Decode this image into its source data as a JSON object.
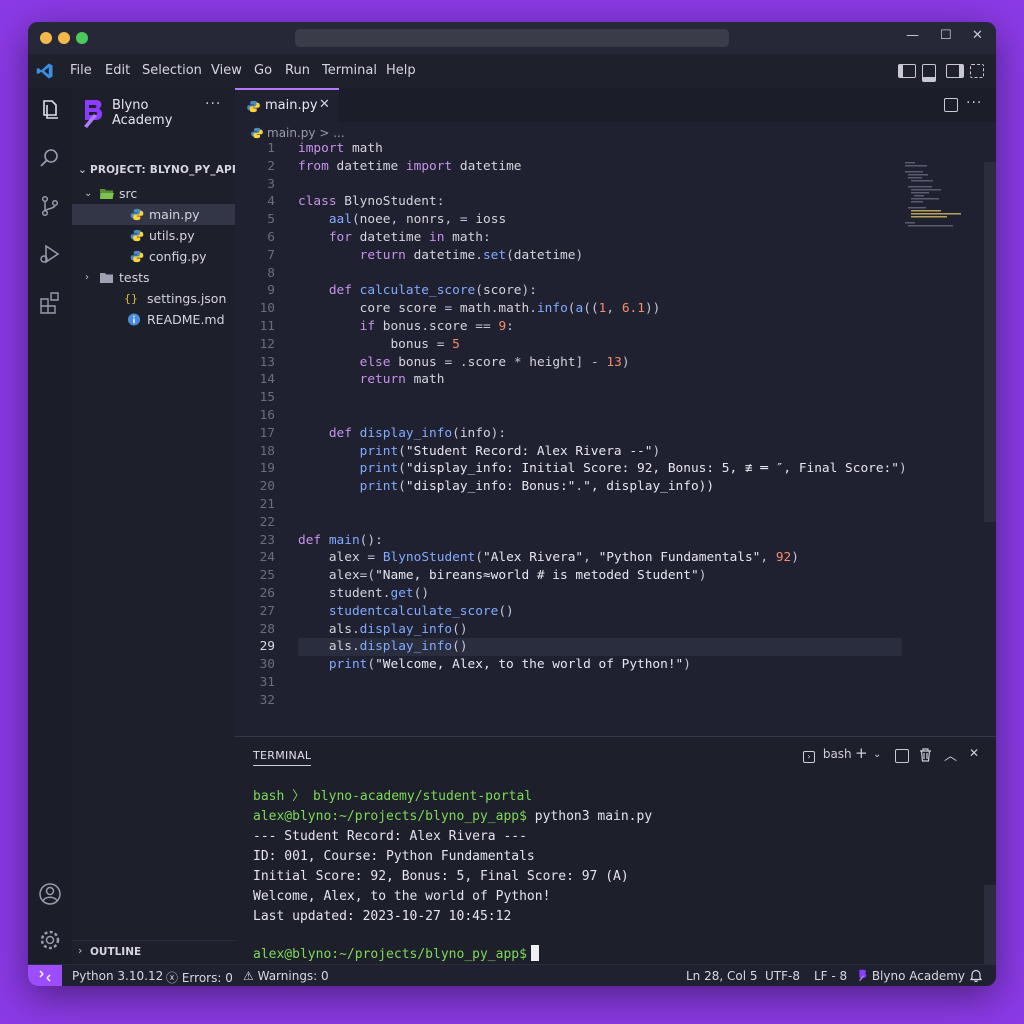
{
  "menu": {
    "items": [
      "File",
      "Edit",
      "Selection",
      "View",
      "Go",
      "Run",
      "Terminal",
      "Help"
    ]
  },
  "sidebar": {
    "brand": "Blyno Academy",
    "ellipsis": "···",
    "project_header": "PROJECT: BLYNO_PY_APP",
    "tree": [
      {
        "label": "src",
        "type": "folder",
        "expanded": true
      },
      {
        "label": "main.py",
        "type": "python",
        "selected": true
      },
      {
        "label": "utils.py",
        "type": "python"
      },
      {
        "label": "config.py",
        "type": "python"
      },
      {
        "label": "tests",
        "type": "folder",
        "expanded": false
      },
      {
        "label": "settings.json",
        "type": "json",
        "icon_text": "{}"
      },
      {
        "label": "README.md",
        "type": "info"
      }
    ],
    "outline": "OUTLINE"
  },
  "editor": {
    "tab_label": "main.py",
    "tab_close": "✕",
    "breadcrumb": "main.py > ...",
    "current_line": 29,
    "lines": [
      "import math",
      "from datetime import datetime",
      "",
      "class BlynoStudent:",
      "    aal(noee, nonrs, = ioss",
      "    for datetime in math:",
      "        return datetime.set(datetime)",
      "",
      "    def calculate_score(score):",
      "        core score = math.math.info(a((1, 6.1))",
      "        if bonus.score == 9:",
      "            bonus = 5",
      "        else bonus = .score * height] - 13)",
      "        return math",
      "",
      "",
      "    def display_info(info):",
      "        print(\"Student Record: Alex Rivera --\")",
      "        print(\"display_info: Initial Score: 92, Bonus: 5, ≢ ═ ″, Final Score:\")",
      "        print(\"display_info: Bonus:\".\", display_info))",
      "",
      "",
      "def main():",
      "    alex = BlynoStudent(\"Alex Rivera\", \"Python Fundamentals\", 92)",
      "    alex=(\"Name, bireans≈world # is metoded Student\")",
      "    student.get()",
      "    studentcalculate_score()",
      "    als.display_info()",
      "    als.display_info()",
      "    print(\"Welcome, Alex, to the world of Python!\")",
      "",
      ""
    ]
  },
  "terminal": {
    "title": "TERMINAL",
    "shell": "bash",
    "prompt_path": "bash 〉 blyno-academy/student-portal",
    "prompt": "alex@blyno:~/projects/blyno_py_app$",
    "command": "python3 main.py",
    "output": [
      "--- Student Record: Alex Rivera ---",
      "ID: 001, Course: Python Fundamentals",
      "Initial Score: 92, Bonus: 5, Final Score: 97 (A)",
      "Welcome, Alex, to the world of Python!",
      "Last updated: 2023-10-27 10:45:12"
    ]
  },
  "status": {
    "python": "Python 3.10.12",
    "errors": "Errors: 0",
    "warnings": "Warnings: 0",
    "position": "Ln 28, Col 5",
    "encoding": "UTF-8",
    "eol": "LF - 8",
    "brand": "Blyno Academy"
  },
  "colors": {
    "accent": "#9b4dff",
    "keyword": "#c792ea",
    "function": "#82aaff",
    "string": "#e6e6ef",
    "prompt_green": "#7ed957"
  }
}
